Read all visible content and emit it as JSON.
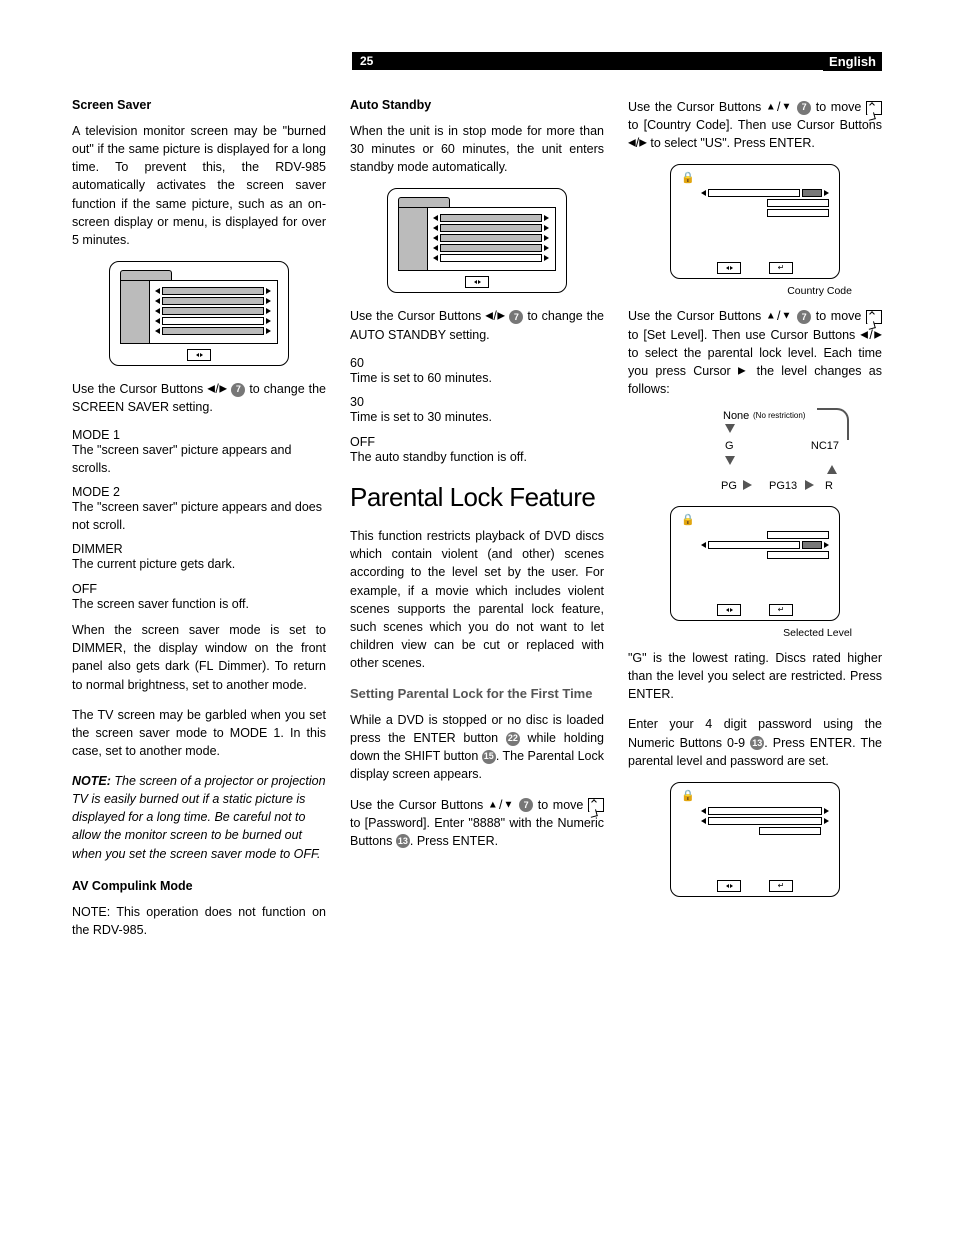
{
  "header": {
    "page_number": "25",
    "language": "English"
  },
  "col1": {
    "screen_saver": {
      "heading": "Screen Saver",
      "intro": "A television monitor screen may be \"burned out\" if the same picture is displayed for a long time. To prevent this, the RDV-985 automatically activates the screen saver function if the same picture, such as an on-screen display or menu, is displayed for over 5 minutes.",
      "use_cursor_pre": "Use the Cursor Buttons ",
      "use_cursor_post": " to change the SCREEN SAVER setting.",
      "circ7": "7",
      "mode1_label": "MODE 1",
      "mode1_desc": "The \"screen saver\" picture appears and scrolls.",
      "mode2_label": "MODE 2",
      "mode2_desc": "The \"screen saver\" picture appears and does not scroll.",
      "dimmer_label": "DIMMER",
      "dimmer_desc": "The current picture gets dark.",
      "off_label": "OFF",
      "off_desc": "The screen saver function is off.",
      "p_dimmer": "When the screen saver mode is set to DIMMER, the display window on the front panel also gets dark (FL Dimmer). To return to normal brightness, set to another mode.",
      "p_garbled": "The TV screen may be garbled when you set the screen saver mode to MODE 1. In this case, set to another mode.",
      "note_label": "NOTE:",
      "note_body": " The screen of a projector or projection TV is easily burned out if a static picture is displayed for a long time. Be careful not to allow the monitor screen to be burned out when you set the screen saver mode to OFF."
    },
    "av_compulink": {
      "heading": "AV Compulink Mode",
      "body": "NOTE: This operation does not function on the RDV-985."
    }
  },
  "col2": {
    "auto_standby": {
      "heading": "Auto Standby",
      "intro": "When the unit is in stop mode for more than 30 minutes or 60 minutes, the unit enters standby mode automatically.",
      "use_cursor_pre": "Use the Cursor Buttons ",
      "use_cursor_post": " to change the AUTO STANDBY setting.",
      "circ7": "7",
      "opt60_label": "60",
      "opt60_desc": "Time is set to 60 minutes.",
      "opt30_label": "30",
      "opt30_desc": "Time is set to 30 minutes.",
      "optoff_label": "OFF",
      "optoff_desc": "The auto standby function is off."
    },
    "parental": {
      "title": "Parental Lock Feature",
      "intro": "This function restricts playback of DVD discs which contain violent (and other) scenes according to the level set by the user. For example, if a movie which includes violent scenes supports the parental lock feature, such scenes which you do not want to let children view can be cut or replaced with other scenes.",
      "first_time_heading": "Setting Parental Lock for the First Time",
      "first_time_p1a": "While a DVD is stopped or no disc is loaded press the ENTER button ",
      "circ22": "22",
      "first_time_p1b": " while holding down the SHIFT button ",
      "circ15": "15",
      "first_time_p1c": ". The Parental Lock display screen appears.",
      "first_time_p2a": "Use the Cursor Buttons ",
      "circ7": "7",
      "first_time_p2b": " to move ",
      "first_time_p2c": " to [Password]. Enter \"8888\" with the Numeric Buttons ",
      "circ13": "13",
      "first_time_p2d": ". Press ENTER."
    }
  },
  "col3": {
    "top_p_a": "Use the Cursor Buttons ",
    "circ7": "7",
    "top_p_b": " to move ",
    "top_p_c": " to [Country Code]. Then use Cursor Buttons ",
    "top_p_d": " to select \"US\". Press ENTER.",
    "caption_country": "Country Code",
    "setlevel_a": "Use the Cursor Buttons ",
    "setlevel_b": " to move ",
    "setlevel_c": " to [Set Level]. Then use Cursor Buttons ",
    "setlevel_d": " to select the parental lock level. Each time you press Cursor ",
    "setlevel_e": " the level changes as follows:",
    "cycle": {
      "none": "None",
      "nores": "(No restriction)",
      "g": "G",
      "nc17": "NC17",
      "pg": "PG",
      "pg13": "PG13",
      "r": "R"
    },
    "caption_level": "Selected Level",
    "g_lowest": "\"G\" is the lowest rating. Discs rated higher than the level you select are restricted. Press ENTER.",
    "pw_a": "Enter your 4 digit password using the Numeric Buttons 0-9 ",
    "circ13": "13",
    "pw_b": ". Press ENTER. The parental level and password are set."
  }
}
